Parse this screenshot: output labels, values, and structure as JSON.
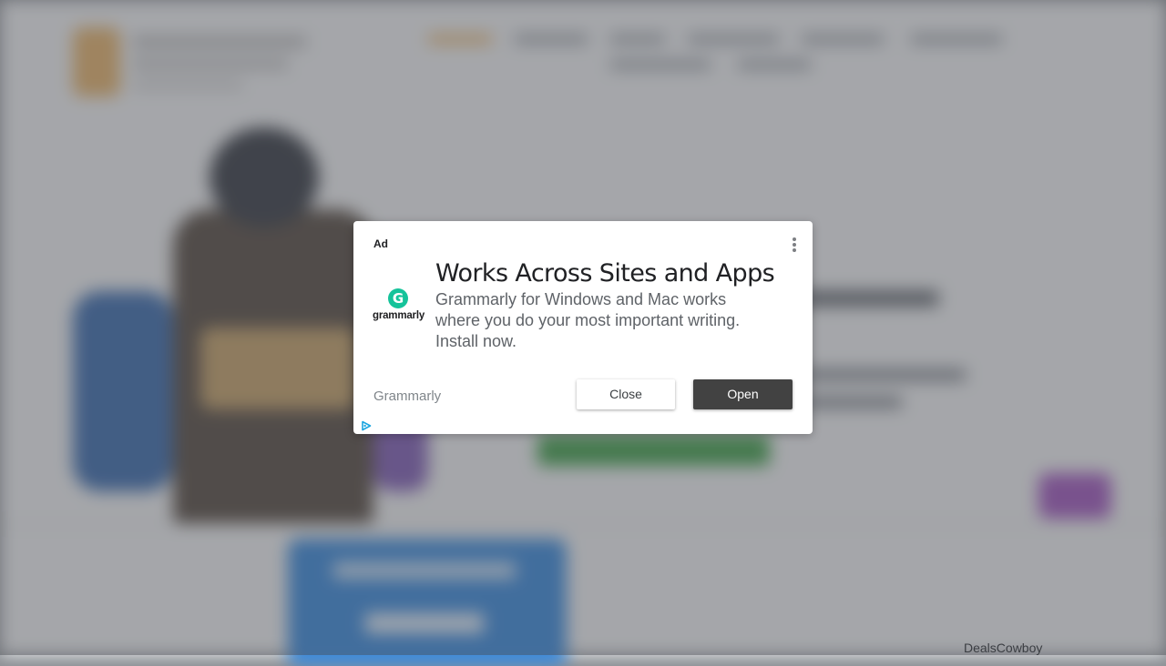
{
  "ad": {
    "label": "Ad",
    "headline": "Works Across Sites and Apps",
    "body": "Grammarly for Windows and Mac works where you do your most important writing. Install now.",
    "advertiser": "Grammarly",
    "logo_letter": "G",
    "logo_text": "grammarly",
    "close_label": "Close",
    "open_label": "Open",
    "icons": {
      "menu": "more-vert-icon",
      "adchoices": "adchoices-icon"
    },
    "colors": {
      "brand": "#15c39a",
      "open_button": "#424242",
      "adchoices": "#1ba5e0"
    }
  },
  "page": {
    "footer_brand": "DealsCowboy"
  }
}
